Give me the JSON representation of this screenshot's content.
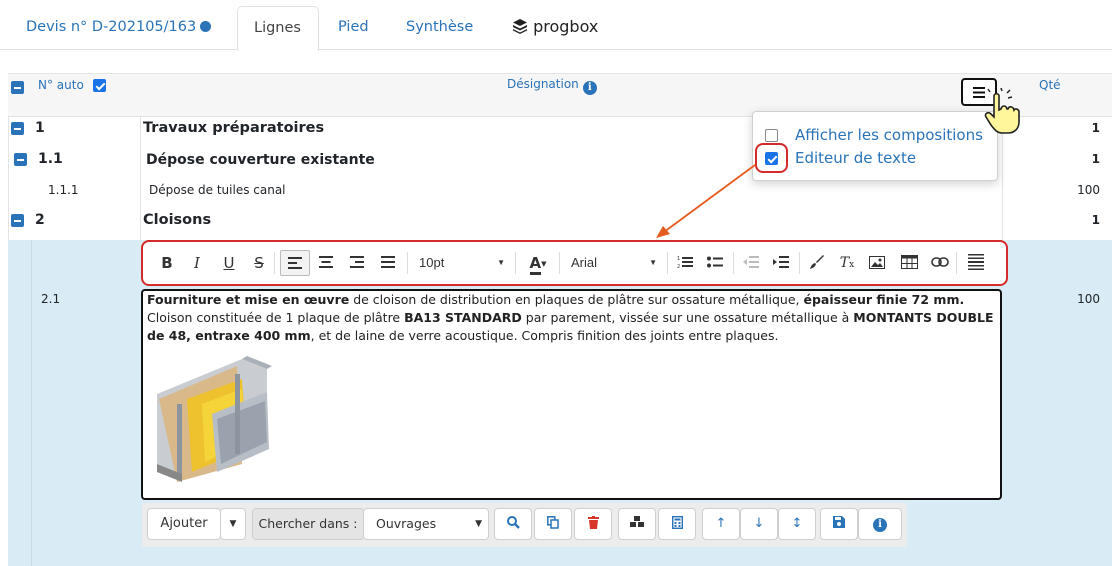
{
  "tabs": {
    "devis": "Devis n° D-202105/163",
    "lignes": "Lignes",
    "pied": "Pied",
    "synthese": "Synthèse",
    "brand": "progbox"
  },
  "header": {
    "no_auto": "N° auto",
    "designation": "Désignation",
    "qte": "Qté"
  },
  "rows": [
    {
      "num": "1",
      "label": "Travaux préparatoires",
      "qty": "1"
    },
    {
      "num": "1.1",
      "label": "Dépose couverture existante",
      "qty": "1"
    },
    {
      "num": "1.1.1",
      "label": "Dépose de tuiles canal",
      "qty": "100"
    },
    {
      "num": "2",
      "label": "Cloisons",
      "qty": "1"
    },
    {
      "num": "2.1",
      "label": "",
      "qty": "100"
    }
  ],
  "menu": {
    "compositions": "Afficher les compositions",
    "editeur": "Editeur de texte"
  },
  "toolbar": {
    "font_size": "10pt",
    "font_family": "Arial"
  },
  "editor": {
    "b1": "Fourniture et mise en œuvre",
    "t1": " de cloison de distribution en plaques de plâtre sur ossature métallique, ",
    "b2": "épaisseur finie 72 mm.",
    "t2": " Cloison constituée de 1 plaque de plâtre ",
    "b3": "BA13 STANDARD",
    "t3": " par parement, vissée sur une ossature métallique à ",
    "b4": "MONTANTS DOUBLE de 48, entraxe 400 mm",
    "t4": ", et de laine de verre acoustique. Compris finition des joints entre plaques."
  },
  "bottom": {
    "ajouter": "Ajouter",
    "chercher": "Chercher dans :",
    "ouvrages": "Ouvrages"
  },
  "colors": {
    "accent": "#2a73b8",
    "highlight": "#d9ebf5",
    "red": "#d42a2a"
  }
}
